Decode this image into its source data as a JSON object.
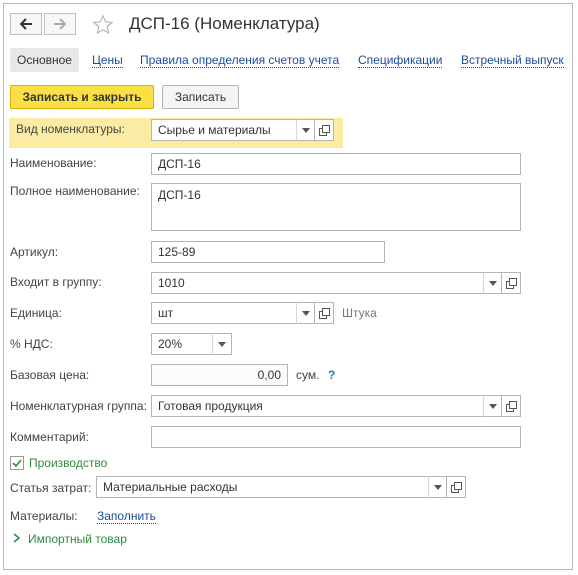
{
  "window": {
    "title": "ДСП-16 (Номенклатура)"
  },
  "nav": {
    "back_icon": "arrow-left-icon",
    "forward_icon": "arrow-right-icon",
    "favorite_icon": "star-icon"
  },
  "tabs": [
    {
      "label": "Основное"
    },
    {
      "label": "Цены"
    },
    {
      "label": "Правила определения счетов учета"
    },
    {
      "label": "Спецификации"
    },
    {
      "label": "Встречный выпуск"
    }
  ],
  "toolbar": {
    "save_close_label": "Записать и закрыть",
    "save_label": "Записать"
  },
  "form": {
    "kind": {
      "label": "Вид номенклатуры:",
      "value": "Сырье и материалы"
    },
    "name": {
      "label": "Наименование:",
      "value": "ДСП-16"
    },
    "full_name": {
      "label": "Полное наименование:",
      "value": "ДСП-16"
    },
    "article": {
      "label": "Артикул:",
      "value": "125-89"
    },
    "group": {
      "label": "Входит в группу:",
      "value": "1010"
    },
    "unit": {
      "label": "Единица:",
      "value": "шт",
      "hint": "Штука"
    },
    "vat": {
      "label": "% НДС:",
      "value": "20%"
    },
    "base_price": {
      "label": "Базовая цена:",
      "value": "0,00",
      "currency": "сум.",
      "help": "?"
    },
    "nom_group": {
      "label": "Номенклатурная группа:",
      "value": "Готовая продукция"
    },
    "comment": {
      "label": "Комментарий:",
      "value": ""
    },
    "production": {
      "label": "Производство",
      "checked": true
    },
    "cost_item": {
      "label": "Статья затрат:",
      "value": "Материальные расходы"
    },
    "materials": {
      "label": "Материалы:",
      "link": "Заполнить"
    },
    "import": {
      "label": "Импортный товар"
    }
  },
  "colors": {
    "accent_yellow": "#fbe045",
    "highlight": "#fbeca5",
    "link": "#1b4c9a",
    "green": "#2f8a3e"
  }
}
